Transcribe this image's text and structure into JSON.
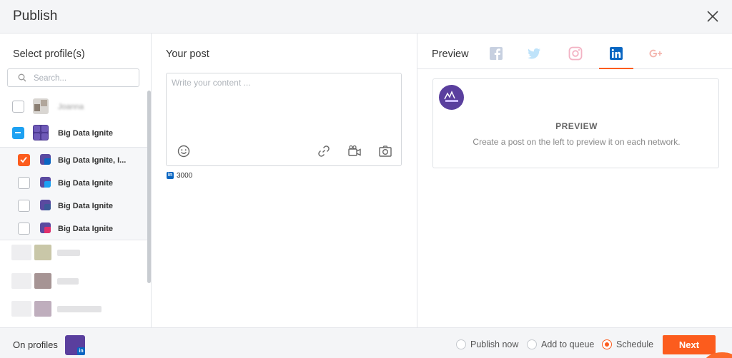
{
  "header": {
    "title": "Publish"
  },
  "left": {
    "title": "Select profile(s)",
    "search_placeholder": "Search...",
    "profiles": [
      {
        "label": "Joanna",
        "state": "unchecked"
      },
      {
        "label": "Big Data Ignite",
        "state": "partial"
      }
    ],
    "children": [
      {
        "label": "Big Data Ignite, I...",
        "state": "checked",
        "network": "linkedin"
      },
      {
        "label": "Big Data Ignite",
        "state": "unchecked",
        "network": "twitter"
      },
      {
        "label": "Big Data Ignite",
        "state": "unchecked",
        "network": "facebook"
      },
      {
        "label": "Big Data Ignite",
        "state": "unchecked",
        "network": "instagram"
      }
    ]
  },
  "middle": {
    "title": "Your post",
    "placeholder": "Write your content ...",
    "char_count": "3000"
  },
  "right": {
    "title": "Preview",
    "tabs": [
      "facebook",
      "twitter",
      "instagram",
      "linkedin",
      "google-plus"
    ],
    "active_tab": "linkedin",
    "preview_title": "PREVIEW",
    "preview_sub": "Create a post on the left to preview it on each network."
  },
  "footer": {
    "on_profiles": "On profiles",
    "options": [
      "Publish now",
      "Add to queue",
      "Schedule"
    ],
    "selected": "Schedule",
    "next_label": "Next"
  },
  "colors": {
    "accent": "#fc5c1d",
    "partial": "#1da1f2",
    "brand": "#5a3f9e"
  }
}
